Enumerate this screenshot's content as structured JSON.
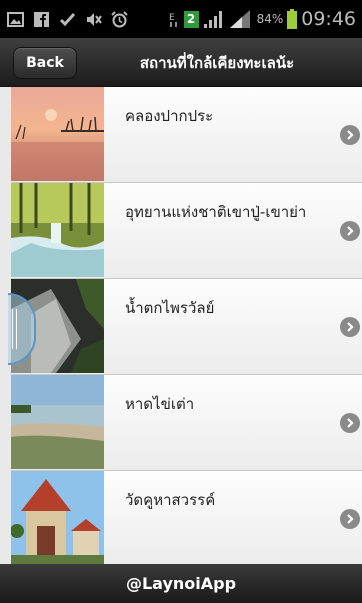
{
  "status_bar": {
    "time": "09:46",
    "battery_percent": "84%",
    "sim_badge": "2",
    "icons": [
      "image-icon",
      "facebook-icon",
      "check-icon",
      "mute-icon",
      "alarm-icon",
      "data-icon",
      "sim-icon",
      "signal-icon",
      "signal-icon",
      "battery-icon"
    ]
  },
  "header": {
    "back_label": "Back",
    "title": "สถานที่ใกล้เคียงทะเลน้ะ"
  },
  "places": [
    {
      "name": "คลองปากประ",
      "thumb": "sunset-lake"
    },
    {
      "name": "อุทยานแห่งชาติเขาปู่-เขาย่า",
      "thumb": "forest-waterfall"
    },
    {
      "name": "น้ำตกไพรวัลย์",
      "thumb": "rock-waterfall"
    },
    {
      "name": "หาดไข่เต่า",
      "thumb": "beach"
    },
    {
      "name": "วัดคูหาสวรรค์",
      "thumb": "temple"
    }
  ],
  "footer": {
    "label": "@LaynoiApp"
  },
  "colors": {
    "header_bg": "#1c1c1c",
    "chevron": "#8a8a8a",
    "list_bg": "#f5f5f5"
  }
}
